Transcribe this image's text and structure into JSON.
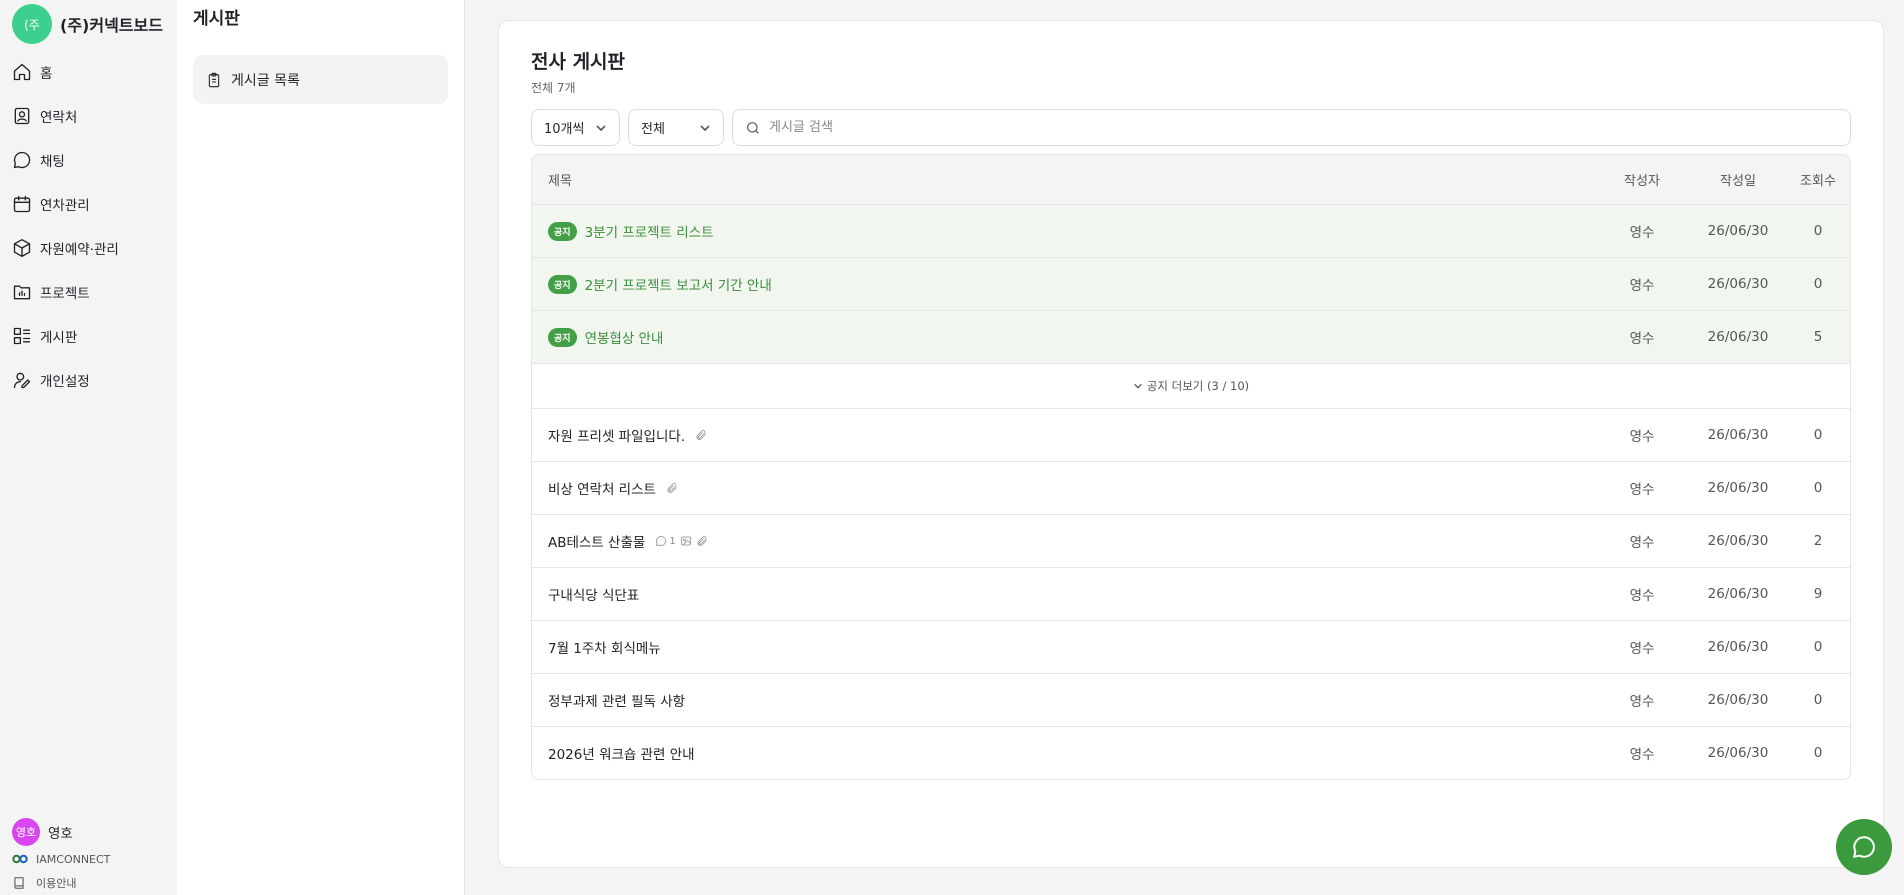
{
  "brand": {
    "logo_text": "(주",
    "name": "(주)커넥트보드",
    "logo_color": "#3ccf8e"
  },
  "nav": {
    "items": [
      {
        "label": "홈",
        "icon": "home-icon"
      },
      {
        "label": "연락처",
        "icon": "contact-icon"
      },
      {
        "label": "채팅",
        "icon": "chat-icon"
      },
      {
        "label": "연차관리",
        "icon": "calendar-icon"
      },
      {
        "label": "자원예약·관리",
        "icon": "box-icon"
      },
      {
        "label": "프로젝트",
        "icon": "folder-chart-icon"
      },
      {
        "label": "게시판",
        "icon": "board-icon"
      },
      {
        "label": "개인설정",
        "icon": "user-settings-icon"
      }
    ]
  },
  "user": {
    "avatar_text": "영호",
    "name": "영호",
    "avatar_color": "#d946ef"
  },
  "footer": {
    "company": "IAMCONNECT",
    "guide": "이용안내"
  },
  "subnav": {
    "title": "게시판",
    "item_label": "게시글 목록"
  },
  "board": {
    "title": "전사 게시판",
    "count": "전체 7개",
    "page_size": "10개씩",
    "filter": "전체",
    "search_placeholder": "게시글 검색",
    "columns": {
      "title": "제목",
      "author": "작성자",
      "date": "작성일",
      "views": "조회수"
    },
    "notice_badge": "공지",
    "notices": [
      {
        "title": "3분기 프로젝트 리스트",
        "author": "영수",
        "date": "26/06/30",
        "views": "0"
      },
      {
        "title": "2분기 프로젝트 보고서 기간 안내",
        "author": "영수",
        "date": "26/06/30",
        "views": "0"
      },
      {
        "title": "연봉협상 안내",
        "author": "영수",
        "date": "26/06/30",
        "views": "5"
      }
    ],
    "more_notices": "공지 더보기 (3 / 10)",
    "posts": [
      {
        "title": "자원 프리셋 파일입니다.",
        "author": "영수",
        "date": "26/06/30",
        "views": "0"
      },
      {
        "title": "비상 연락처 리스트",
        "author": "영수",
        "date": "26/06/30",
        "views": "0"
      },
      {
        "title": "AB테스트 산출물",
        "comment_count": "1",
        "author": "영수",
        "date": "26/06/30",
        "views": "2"
      },
      {
        "title": "구내식당 식단표",
        "author": "영수",
        "date": "26/06/30",
        "views": "9"
      },
      {
        "title": "7월 1주차 회식메뉴",
        "author": "영수",
        "date": "26/06/30",
        "views": "0"
      },
      {
        "title": "정부과제 관련 필독 사항",
        "author": "영수",
        "date": "26/06/30",
        "views": "0"
      },
      {
        "title": "2026년 워크숍 관련 안내",
        "author": "영수",
        "date": "26/06/30",
        "views": "0"
      }
    ]
  },
  "colors": {
    "accent": "#43a047",
    "notice_bg": "#f1f7ef",
    "fab": "#3c9a3e"
  }
}
